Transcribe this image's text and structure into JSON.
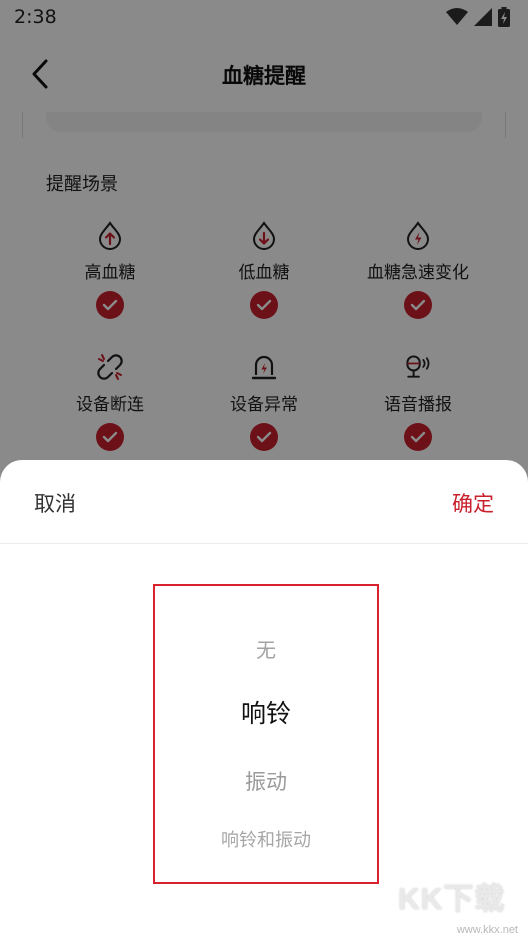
{
  "status_bar": {
    "time": "2:38",
    "icons": [
      "wifi-icon",
      "signal-icon",
      "battery-charging-icon"
    ]
  },
  "nav": {
    "title": "血糖提醒",
    "back_icon": "chevron-left-icon"
  },
  "reminder_scenes": {
    "title": "提醒场景",
    "items": [
      {
        "label": "高血糖",
        "icon": "drop-arrow-up-icon",
        "checked": true
      },
      {
        "label": "低血糖",
        "icon": "drop-arrow-down-icon",
        "checked": true
      },
      {
        "label": "血糖急速变化",
        "icon": "drop-lightning-icon",
        "checked": true
      },
      {
        "label": "设备断连",
        "icon": "broken-link-icon",
        "checked": true
      },
      {
        "label": "设备异常",
        "icon": "device-alert-icon",
        "checked": true
      },
      {
        "label": "语音播报",
        "icon": "voice-broadcast-icon",
        "checked": true
      }
    ]
  },
  "sheet": {
    "cancel_label": "取消",
    "confirm_label": "确定",
    "options": [
      "无",
      "响铃",
      "振动",
      "响铃和振动"
    ],
    "selected": "响铃"
  },
  "watermark": {
    "text": "KK下载",
    "url": "www.kkx.net"
  },
  "colors": {
    "accent": "#c8202c",
    "overlay": "rgba(0,0,0,0.46)"
  }
}
